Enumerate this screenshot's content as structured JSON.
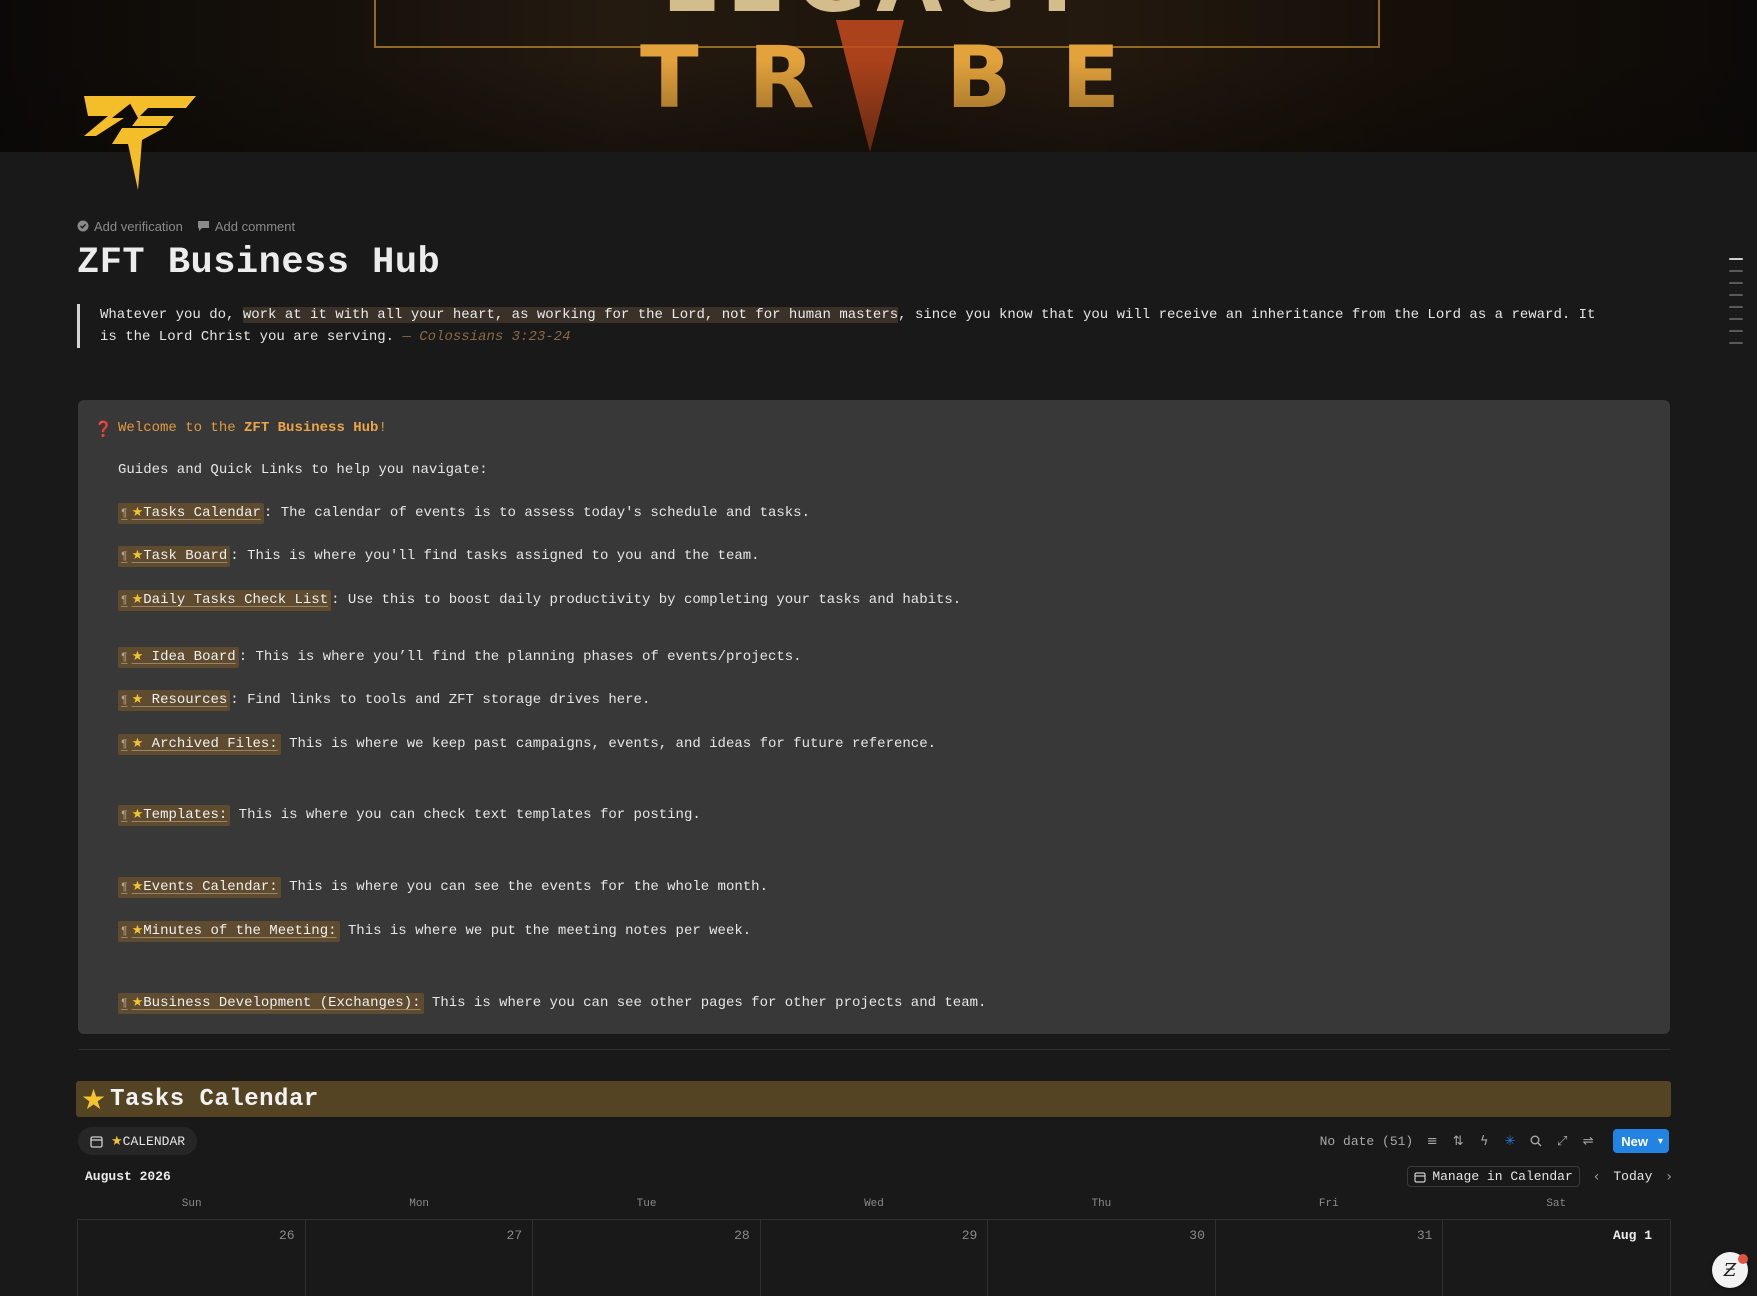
{
  "cover": {
    "top_word": "LEGACY",
    "word_letters": [
      "T",
      "R",
      "I",
      "B",
      "E"
    ]
  },
  "meta": {
    "add_verification": "Add verification",
    "add_comment": "Add comment"
  },
  "page": {
    "title": "ZFT Business Hub"
  },
  "quote": {
    "before": "Whatever you do, ",
    "highlight": "work at it with all your heart, as working for the Lord, not for human masters",
    "after": ", since you know that you will receive an inheritance from the Lord as a reward. It is the Lord Christ you are serving. ",
    "citation": "— Colossians 3:23-24"
  },
  "callout": {
    "icon": "❓",
    "welcome_prefix": "Welcome to the ",
    "welcome_bold": "ZFT Business Hub",
    "welcome_suffix": "!",
    "intro": "Guides and Quick Links to help you navigate:",
    "links": [
      {
        "label": "Tasks Calendar",
        "desc": ": The calendar of events is to assess today's schedule and tasks."
      },
      {
        "label": "Task Board",
        "desc": ": This is where you'll find tasks assigned to you and the team."
      },
      {
        "label": "Daily Tasks Check List",
        "desc": ": Use this to boost daily productivity by completing your tasks and habits."
      },
      {
        "label": " Idea Board",
        "desc": ": This is where you’ll find the planning phases of events/projects."
      },
      {
        "label": " Resources",
        "desc": ": Find links to tools and ZFT storage drives here."
      },
      {
        "label": " Archived Files:",
        "desc": " This is where we keep past campaigns, events, and ideas for future reference."
      },
      {
        "label": "Templates:",
        "desc": " This is where you can check text templates for posting."
      },
      {
        "label": "Events Calendar:",
        "desc": " This is where you can see the events for the whole month."
      },
      {
        "label": "Minutes of the Meeting:",
        "desc": " This is where we put the meeting notes per week."
      },
      {
        "label": "Business Development (Exchanges):",
        "desc": " This is where you can see other pages for other projects and team."
      }
    ]
  },
  "section": {
    "title": "Tasks Calendar"
  },
  "view": {
    "tab_label": "CALENDAR",
    "no_date": "No date (51)",
    "new_button": "New"
  },
  "calendar": {
    "month": "August 2026",
    "manage": "Manage in Calendar",
    "today": "Today",
    "weekdays": [
      "Sun",
      "Mon",
      "Tue",
      "Wed",
      "Thu",
      "Fri",
      "Sat"
    ],
    "dates": [
      "26",
      "27",
      "28",
      "29",
      "30",
      "31",
      "Aug 1"
    ]
  },
  "colors": {
    "background": "#191919",
    "callout_bg": "#383838",
    "chip_bg": "#5e4b30",
    "section_bg": "#544424",
    "accent_blue": "#2383e2",
    "star": "#f4c430"
  }
}
